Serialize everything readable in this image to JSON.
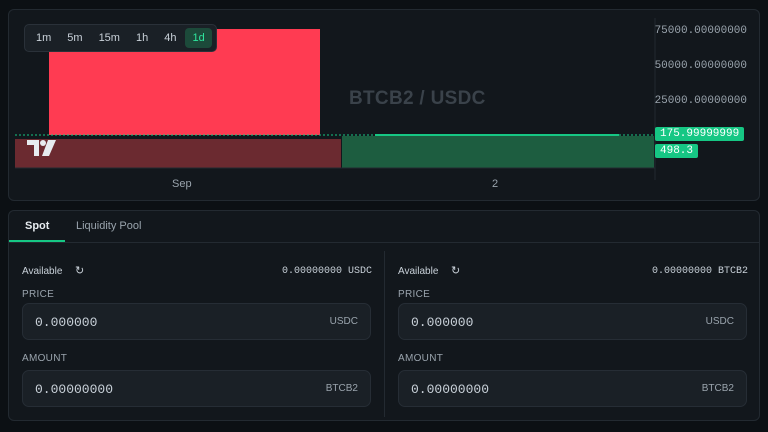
{
  "chart": {
    "timeframes": [
      {
        "label": "1m",
        "active": false
      },
      {
        "label": "5m",
        "active": false
      },
      {
        "label": "15m",
        "active": false
      },
      {
        "label": "1h",
        "active": false
      },
      {
        "label": "4h",
        "active": false
      },
      {
        "label": "1d",
        "active": true
      }
    ],
    "watermark": "BTCB2 / USDC",
    "logo_text": "TV",
    "y_labels": [
      "75000.00000000",
      "50000.00000000",
      "25000.00000000"
    ],
    "price_tag": "175.99999999",
    "volume_tag": "498.3",
    "x_labels": [
      "Sep",
      "2"
    ],
    "colors": {
      "up": "#16c784",
      "down": "#ff3b52",
      "up_vol": "#1d5d40",
      "down_vol": "#6b2a30"
    }
  },
  "trade": {
    "tabs": {
      "spot": "Spot",
      "liquidity": "Liquidity Pool"
    },
    "buy": {
      "available_label": "Available",
      "available_value": "0.00000000 USDC",
      "price_label": "PRICE",
      "price_value": "0.000000",
      "price_unit": "USDC",
      "amount_label": "AMOUNT",
      "amount_value": "0.00000000",
      "amount_unit": "BTCB2"
    },
    "sell": {
      "available_label": "Available",
      "available_value": "0.00000000 BTCB2",
      "price_label": "PRICE",
      "price_value": "0.000000",
      "price_unit": "USDC",
      "amount_label": "AMOUNT",
      "amount_value": "0.00000000",
      "amount_unit": "BTCB2"
    }
  }
}
